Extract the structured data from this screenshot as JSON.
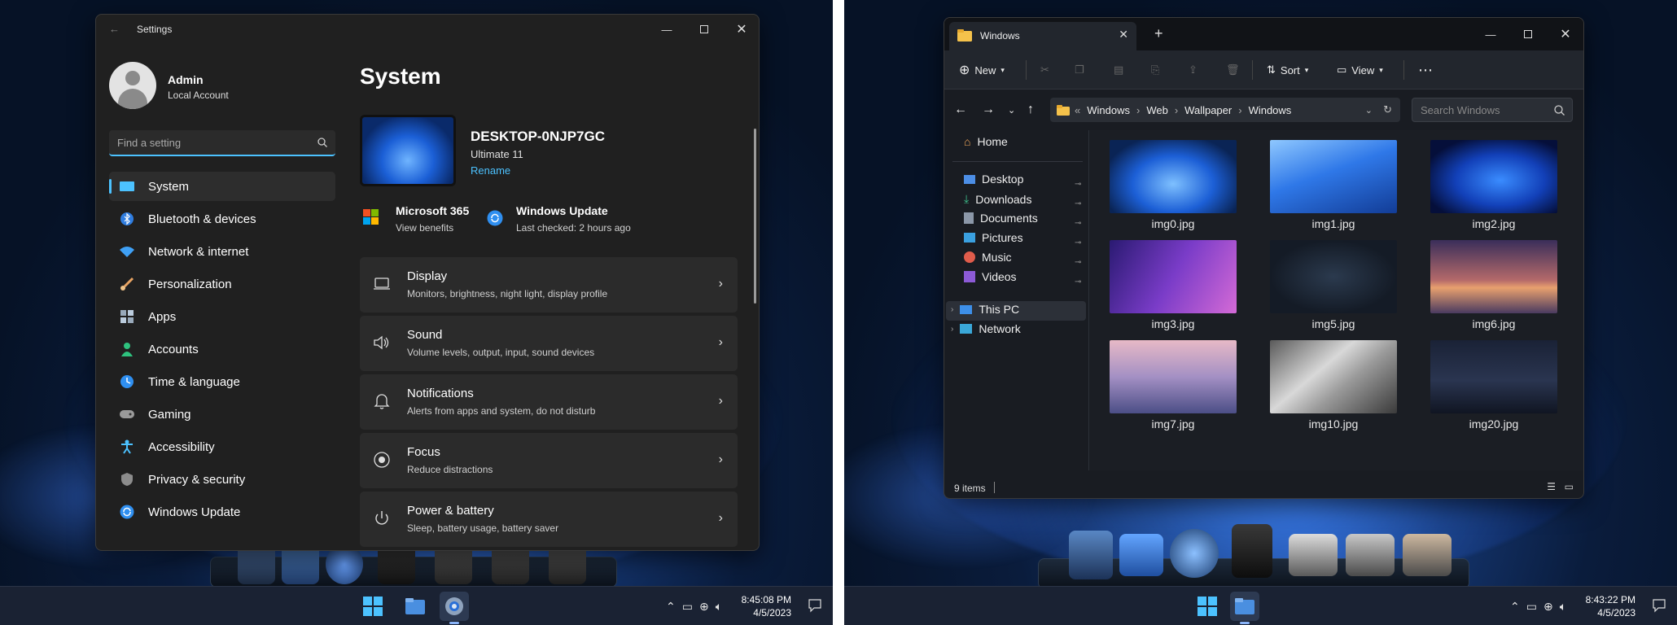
{
  "left_screen": {
    "settings": {
      "title": "Settings",
      "user_name": "Admin",
      "user_account": "Local Account",
      "search_placeholder": "Find a setting",
      "nav": [
        {
          "label": "System",
          "icon": "display-icon"
        },
        {
          "label": "Bluetooth & devices",
          "icon": "bluetooth-icon"
        },
        {
          "label": "Network & internet",
          "icon": "wifi-icon"
        },
        {
          "label": "Personalization",
          "icon": "brush-icon"
        },
        {
          "label": "Apps",
          "icon": "apps-icon"
        },
        {
          "label": "Accounts",
          "icon": "person-icon"
        },
        {
          "label": "Time & language",
          "icon": "globe-clock-icon"
        },
        {
          "label": "Gaming",
          "icon": "gamepad-icon"
        },
        {
          "label": "Accessibility",
          "icon": "accessibility-icon"
        },
        {
          "label": "Privacy & security",
          "icon": "shield-icon"
        },
        {
          "label": "Windows Update",
          "icon": "update-icon"
        }
      ],
      "page_title": "System",
      "device_name": "DESKTOP-0NJP7GC",
      "edition": "Ultimate 11",
      "rename": "Rename",
      "ms365_title": "Microsoft 365",
      "ms365_sub": "View benefits",
      "wu_title": "Windows Update",
      "wu_sub": "Last checked: 2 hours ago",
      "cards": [
        {
          "title": "Display",
          "sub": "Monitors, brightness, night light, display profile"
        },
        {
          "title": "Sound",
          "sub": "Volume levels, output, input, sound devices"
        },
        {
          "title": "Notifications",
          "sub": "Alerts from apps and system, do not disturb"
        },
        {
          "title": "Focus",
          "sub": "Reduce distractions"
        },
        {
          "title": "Power & battery",
          "sub": "Sleep, battery usage, battery saver"
        }
      ]
    },
    "clock_time": "8:45:08 PM",
    "clock_date": "4/5/2023"
  },
  "right_screen": {
    "explorer": {
      "tab_title": "Windows",
      "toolbar": {
        "new": "New",
        "sort": "Sort",
        "view": "View"
      },
      "breadcrumb": [
        "Windows",
        "Web",
        "Wallpaper",
        "Windows"
      ],
      "search_placeholder": "Search Windows",
      "sidebar": {
        "home": "Home",
        "quick": [
          "Desktop",
          "Downloads",
          "Documents",
          "Pictures",
          "Music",
          "Videos"
        ],
        "this_pc": "This PC",
        "network": "Network"
      },
      "files": [
        "img0.jpg",
        "img1.jpg",
        "img2.jpg",
        "img3.jpg",
        "img5.jpg",
        "img6.jpg",
        "img7.jpg",
        "img10.jpg",
        "img20.jpg"
      ],
      "status": "9 items"
    },
    "clock_time": "8:43:22 PM",
    "clock_date": "4/5/2023"
  },
  "colors": {
    "accent": "#4cc2ff",
    "window_bg": "#202020",
    "card_bg": "#2b2b2b",
    "taskbar": "#1a2233"
  }
}
